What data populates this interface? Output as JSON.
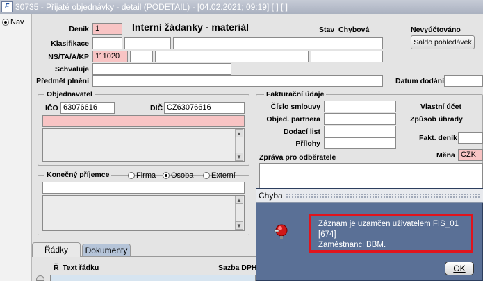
{
  "window": {
    "title": "30735 - Přijaté objednávky - detail (PODETAIL) - [04.02.2021; 09:19]  [ ]  [ ]",
    "app_icon": "F"
  },
  "left_panel": {
    "radio_label": "Nav"
  },
  "header": {
    "form_title": "Interní žádanky - materiál",
    "denik_label": "Deník",
    "denik_value": "1",
    "klasifikace_label": "Klasifikace",
    "ns_label": "NS/TA/A/KP",
    "ns_value": "111020",
    "schvaluje_label": "Schvaluje",
    "predmet_label": "Předmět plnění",
    "stav_label": "Stav",
    "stav_value": "Chybová",
    "nevyuctovano_label": "Nevyúčtováno",
    "saldo_button": "Saldo pohledávek",
    "datum_dodani_label": "Datum dodání"
  },
  "objednavatel": {
    "legend": "Objednavatel",
    "ico_label": "IČO",
    "ico_value": "63076616",
    "dic_label": "DIČ",
    "dic_value": "CZ63076616"
  },
  "konecny_prijemce": {
    "legend": "Konečný příjemce",
    "options": [
      "Firma",
      "Osoba",
      "Externí"
    ],
    "selected": "Osoba"
  },
  "fakturacni": {
    "legend": "Fakturační údaje",
    "cislo_smlouvy_label": "Číslo smlouvy",
    "objed_partnera_label": "Objed. partnera",
    "dodaci_list_label": "Dodací list",
    "prilohy_label": "Přílohy",
    "zprava_label": "Zpráva pro odběratele",
    "vlastni_ucet_label": "Vlastní účet",
    "zpusob_uhrady_label": "Způsob úhrady",
    "fakt_denik_label": "Fakt. deník",
    "mena_label": "Měna",
    "mena_value": "CZK"
  },
  "tabs": [
    {
      "label": "Řádky"
    },
    {
      "label": "Dokumenty"
    }
  ],
  "table": {
    "col_r": "Ř",
    "col_text": "Text řádku",
    "col_dph": "Sazba DPH"
  },
  "dialog": {
    "title": "Chyba",
    "message_line1": "Záznam je uzamčen uživatelem FIS_01 [674]",
    "message_line2": "Zaměstnanci BBM.",
    "ok_button": "OK"
  }
}
